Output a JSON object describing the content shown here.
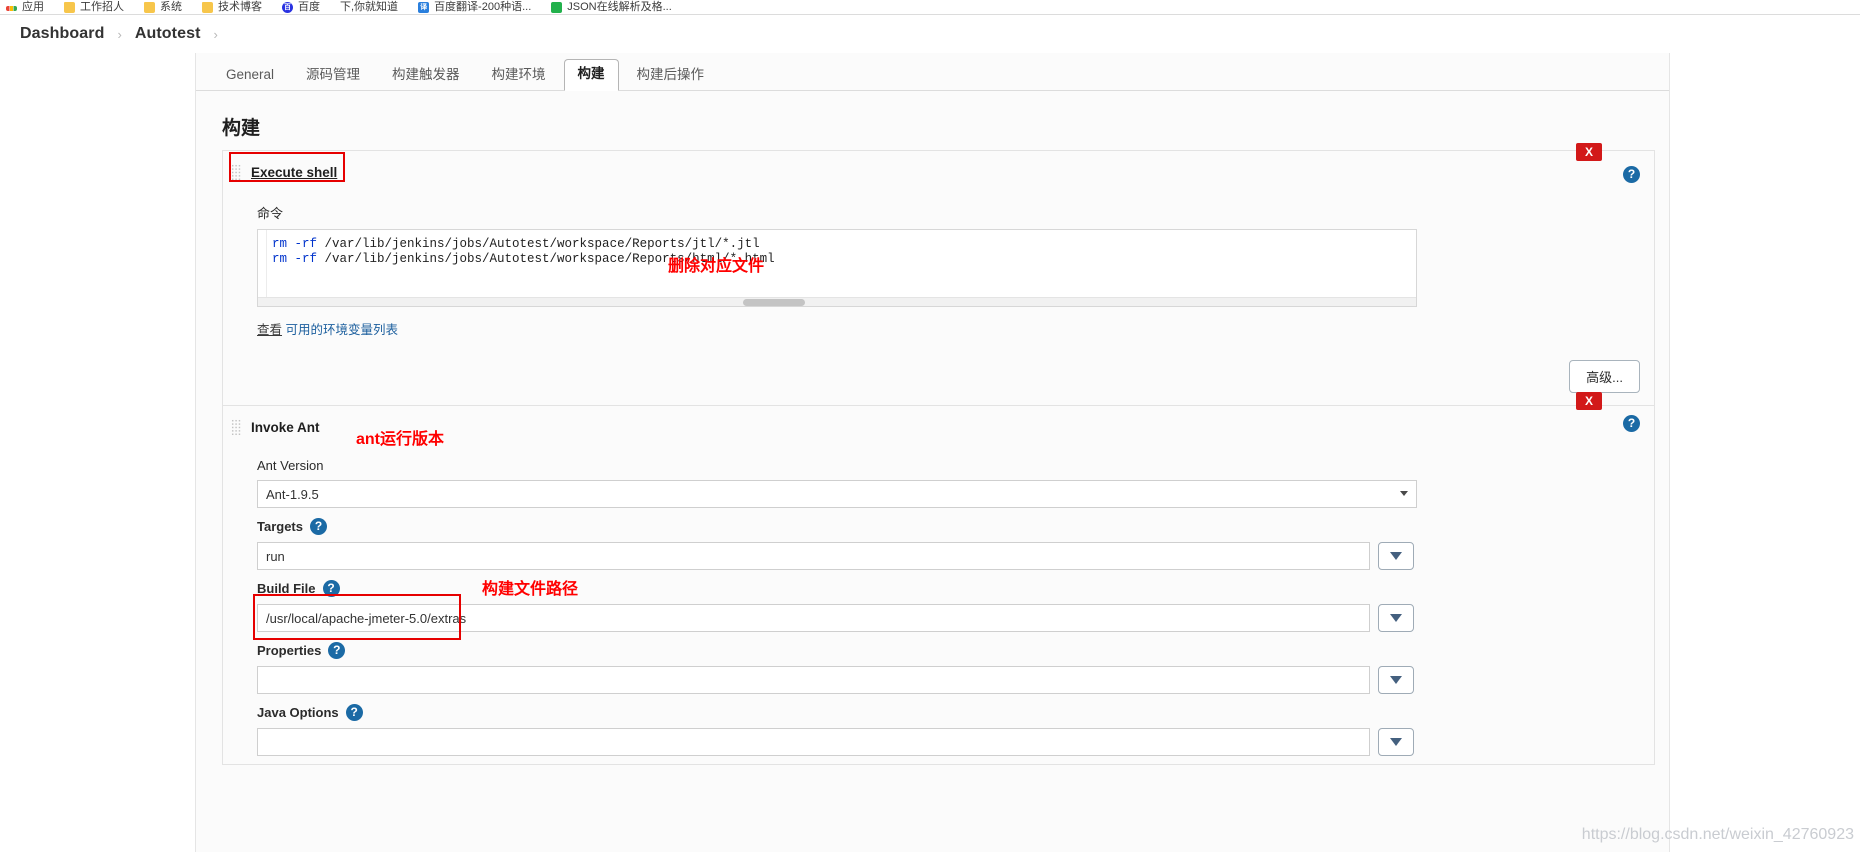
{
  "browser": {
    "bookmarks": [
      {
        "label": "应用",
        "icon": "apps-icon"
      },
      {
        "label": "工作招人",
        "icon": "folder-icon"
      },
      {
        "label": "系统",
        "icon": "folder-icon"
      },
      {
        "label": "技术博客",
        "icon": "folder-icon"
      },
      {
        "label": "百度",
        "icon": "baidu-icon"
      },
      {
        "label": "下,你就知道",
        "icon": "none-icon"
      },
      {
        "label": "百度翻译-200种语...",
        "icon": "fanyi-icon"
      },
      {
        "label": "JSON在线解析及格...",
        "icon": "json-icon"
      }
    ]
  },
  "breadcrumb": {
    "items": [
      "Dashboard",
      "Autotest"
    ],
    "separator": "›",
    "trailing_separator": "›"
  },
  "tabs": [
    {
      "label": "General",
      "active": false
    },
    {
      "label": "源码管理",
      "active": false
    },
    {
      "label": "构建触发器",
      "active": false
    },
    {
      "label": "构建环境",
      "active": false
    },
    {
      "label": "构建",
      "active": true
    },
    {
      "label": "构建后操作",
      "active": false
    }
  ],
  "section": {
    "title": "构建"
  },
  "builders": [
    {
      "name": "Execute shell",
      "delete_label": "X",
      "help_label": "?",
      "command_label": "命令",
      "command_lines": [
        {
          "kw": "rm -rf",
          "rest": " /var/lib/jenkins/jobs/Autotest/workspace/Reports/jtl/*.jtl"
        },
        {
          "kw": "rm -rf",
          "rest": " /var/lib/jenkins/jobs/Autotest/workspace/Reports/html/*.html"
        }
      ],
      "env_link_prefix": "查看",
      "env_link_text": "可用的环境变量列表",
      "advanced_label": "高级..."
    },
    {
      "name": "Invoke Ant",
      "delete_label": "X",
      "help_label": "?",
      "fields": [
        {
          "label": "Ant Version",
          "value": "Ant-1.9.5",
          "type": "select",
          "has_help": false,
          "has_dropdown": false
        },
        {
          "label": "Targets",
          "value": "run",
          "type": "text",
          "has_help": true,
          "has_dropdown": true
        },
        {
          "label": "Build File",
          "value": "/usr/local/apache-jmeter-5.0/extras",
          "type": "text",
          "has_help": true,
          "has_dropdown": true
        },
        {
          "label": "Properties",
          "value": "",
          "type": "text",
          "has_help": true,
          "has_dropdown": true
        },
        {
          "label": "Java Options",
          "value": "",
          "type": "text",
          "has_help": true,
          "has_dropdown": true
        }
      ]
    }
  ],
  "annotations": [
    {
      "text": "删除对应文件",
      "color": "#ff0000"
    },
    {
      "text": "ant运行版本",
      "color": "#ff0000"
    },
    {
      "text": "构建文件路径",
      "color": "#ff0000"
    }
  ],
  "watermark": {
    "text": "https://blog.csdn.net/weixin_42760923"
  },
  "colors": {
    "accent": "#1b6aa5",
    "danger": "#d21919",
    "annotation": "#ff0000",
    "panel_bg": "#fbfbfb"
  }
}
